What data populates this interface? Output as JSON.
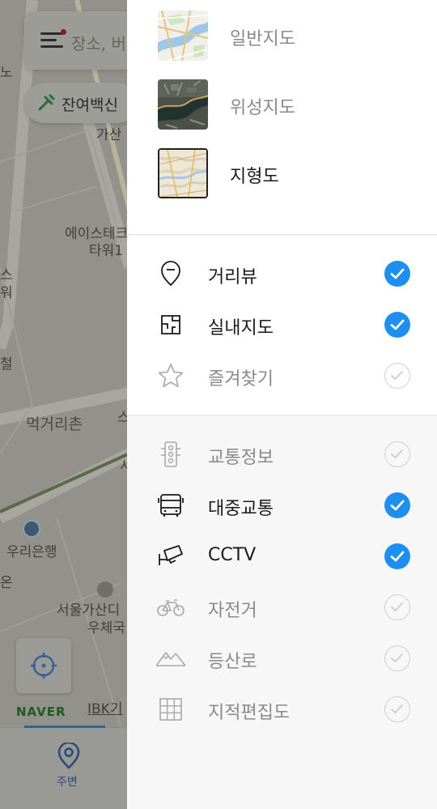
{
  "map": {
    "search_placeholder": "장소, 버",
    "chip_label": "잔여백신",
    "labels": [
      "노",
      "가산",
      "에이스테크",
      "타워1",
      "스",
      "워",
      "철",
      "먹거리촌",
      "스",
      "서",
      "우리은행",
      "온",
      "서울가산디",
      "우체국",
      "IBK기"
    ],
    "logo": "NAVER",
    "nav_label": "주변",
    "icons": [
      "menu-icon",
      "syringe-icon",
      "location-target-icon",
      "nearby-icon",
      "bank-icon",
      "post-icon"
    ]
  },
  "panel": {
    "map_types": [
      {
        "label": "일반지도",
        "selected": false,
        "thumb": "general-map-thumbnail"
      },
      {
        "label": "위성지도",
        "selected": false,
        "thumb": "satellite-map-thumbnail"
      },
      {
        "label": "지형도",
        "selected": true,
        "thumb": "terrain-map-thumbnail"
      }
    ],
    "layers": [
      {
        "label": "거리뷰",
        "checked": true,
        "icon": "street-view-icon"
      },
      {
        "label": "실내지도",
        "checked": true,
        "icon": "indoor-map-icon"
      },
      {
        "label": "즐겨찾기",
        "checked": false,
        "icon": "star-icon"
      }
    ],
    "overlays": [
      {
        "label": "교통정보",
        "checked": false,
        "icon": "traffic-light-icon"
      },
      {
        "label": "대중교통",
        "checked": true,
        "icon": "bus-icon"
      },
      {
        "label": "CCTV",
        "checked": true,
        "icon": "cctv-icon"
      },
      {
        "label": "자전거",
        "checked": false,
        "icon": "bicycle-icon"
      },
      {
        "label": "등산로",
        "checked": false,
        "icon": "mountain-icon"
      },
      {
        "label": "지적편집도",
        "checked": false,
        "icon": "cadastral-grid-icon"
      }
    ]
  },
  "colors": {
    "check_on": "#1f8ef1",
    "check_off_border": "#cfcfcf",
    "label_on": "#1a1a1a",
    "label_off": "#8a8a8a"
  }
}
